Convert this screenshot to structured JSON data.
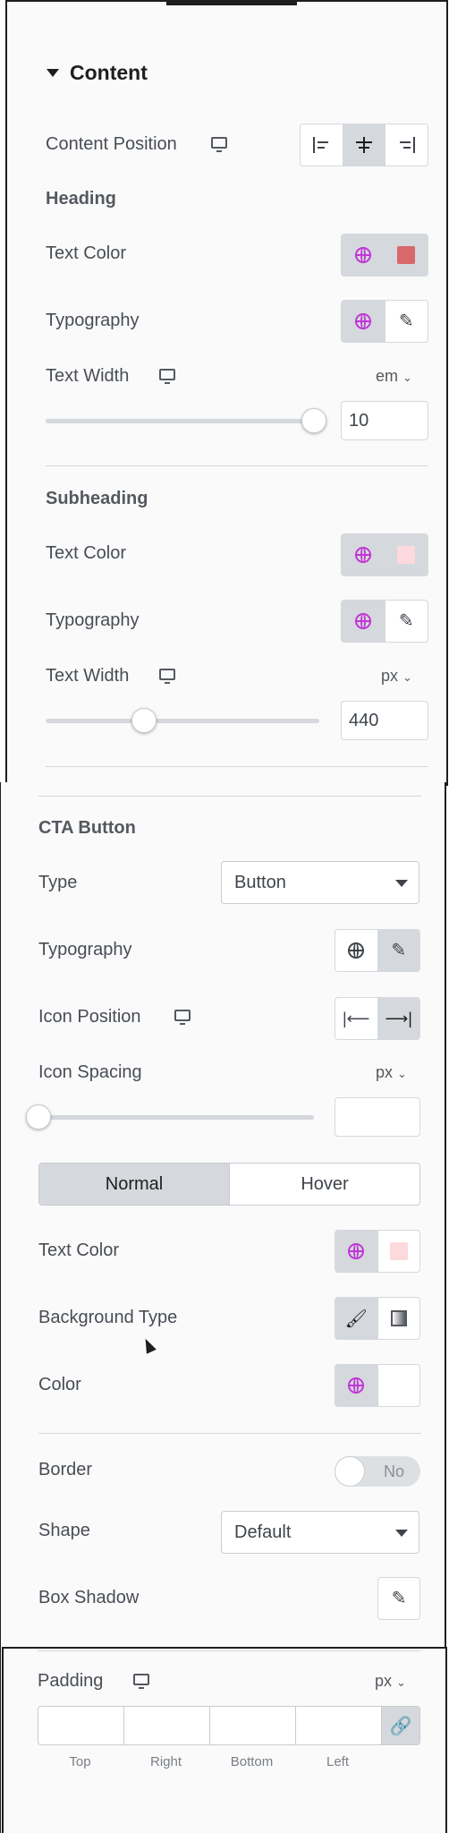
{
  "content_section": {
    "title": "Content",
    "content_position_label": "Content Position",
    "heading": {
      "title": "Heading",
      "text_color_label": "Text Color",
      "text_color": "#d8686c",
      "typography_label": "Typography",
      "text_width_label": "Text Width",
      "unit": "em",
      "value": "10",
      "slider_fraction": 0.98
    },
    "subheading": {
      "title": "Subheading",
      "text_color_label": "Text Color",
      "text_color": "#fbd9dc",
      "typography_label": "Typography",
      "text_width_label": "Text Width",
      "unit": "px",
      "value": "440",
      "slider_fraction": 0.36
    }
  },
  "cta_button": {
    "title": "CTA Button",
    "type_label": "Type",
    "type_value": "Button",
    "typography_label": "Typography",
    "icon_position_label": "Icon Position",
    "icon_spacing_label": "Icon Spacing",
    "icon_spacing_unit": "px",
    "icon_spacing_value": "",
    "icon_spacing_fraction": 0.0,
    "tabs": [
      "Normal",
      "Hover"
    ],
    "text_color_label": "Text Color",
    "text_color": "#fbd9dc",
    "background_type_label": "Background Type",
    "color_label": "Color",
    "color_value": "#ffffff",
    "border_label": "Border",
    "border_toggle": "No",
    "shape_label": "Shape",
    "shape_value": "Default",
    "box_shadow_label": "Box Shadow",
    "padding_label": "Padding",
    "padding_unit": "px",
    "padding_fields": [
      "Top",
      "Right",
      "Bottom",
      "Left"
    ]
  },
  "colors": {
    "global_accent": "#c036d6",
    "active_bg": "#d5d8dc"
  }
}
